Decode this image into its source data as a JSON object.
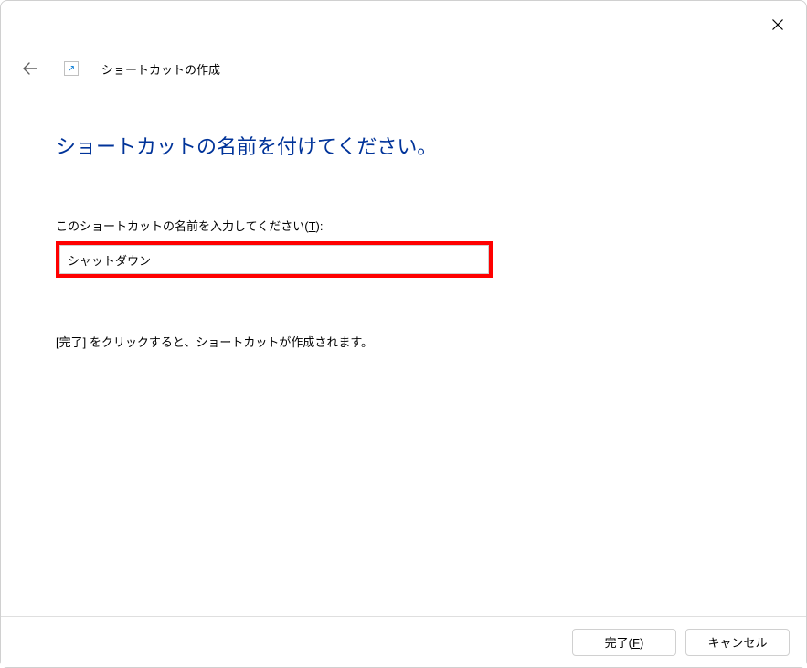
{
  "window": {
    "title": "ショートカットの作成"
  },
  "content": {
    "heading": "ショートカットの名前を付けてください。",
    "input_label_prefix": "このショートカットの名前を入力してください(",
    "input_label_key": "T",
    "input_label_suffix": "):",
    "input_value": "シャットダウン",
    "info_text": "[完了] をクリックすると、ショートカットが作成されます。"
  },
  "footer": {
    "finish_prefix": "完了(",
    "finish_key": "F",
    "finish_suffix": ")",
    "cancel": "キャンセル"
  }
}
